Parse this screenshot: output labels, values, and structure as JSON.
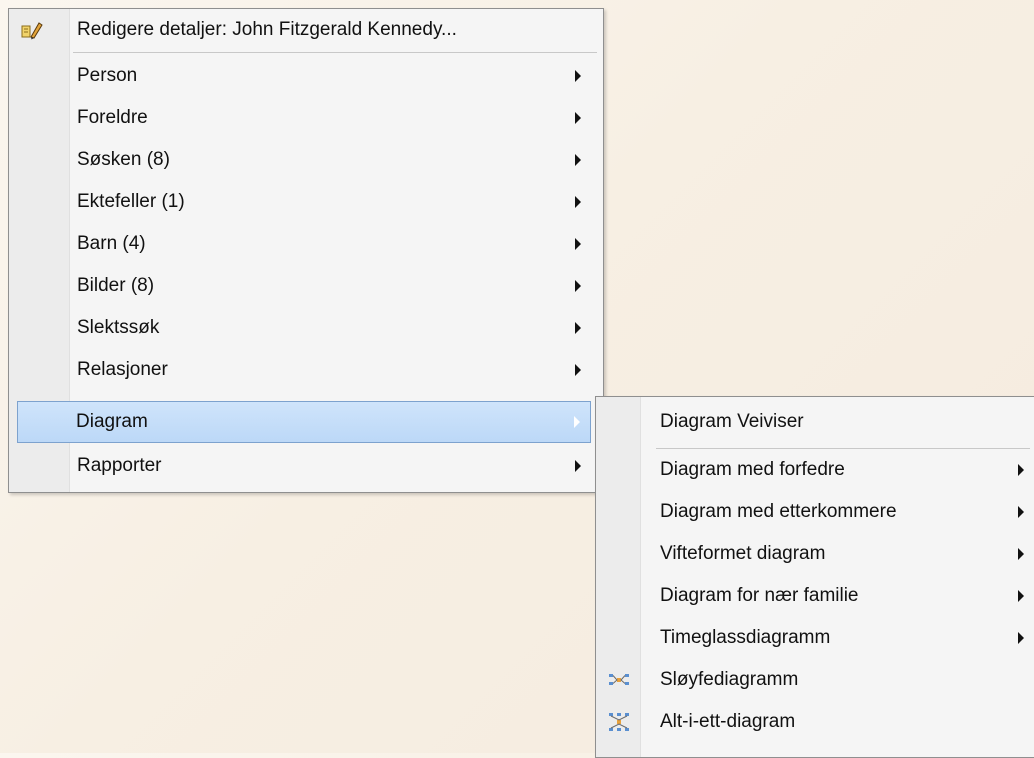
{
  "main_menu": {
    "edit_item": "Redigere detaljer: John Fitzgerald Kennedy...",
    "items": [
      {
        "label": "Person"
      },
      {
        "label": "Foreldre"
      },
      {
        "label": "Søsken (8)"
      },
      {
        "label": "Ektefeller (1)"
      },
      {
        "label": "Barn (4)"
      },
      {
        "label": "Bilder (8)"
      },
      {
        "label": "Slektssøk"
      },
      {
        "label": "Relasjoner"
      },
      {
        "label": "Diagram"
      },
      {
        "label": "Rapporter"
      }
    ]
  },
  "sub_menu": {
    "wizard": "Diagram Veiviser",
    "items": [
      {
        "label": "Diagram med forfedre"
      },
      {
        "label": "Diagram med etterkommere"
      },
      {
        "label": "Vifteformet diagram"
      },
      {
        "label": "Diagram for nær familie"
      },
      {
        "label": "Timeglassdiagramm"
      },
      {
        "label": "Sløyfediagramm",
        "icon": "bowtie-chart-icon"
      },
      {
        "label": "Alt-i-ett-diagram",
        "icon": "all-in-one-chart-icon"
      }
    ]
  },
  "colors": {
    "highlight": "#c4ddf8",
    "highlight_border": "#7da2ce",
    "menu_bg": "#f5f5f5"
  }
}
